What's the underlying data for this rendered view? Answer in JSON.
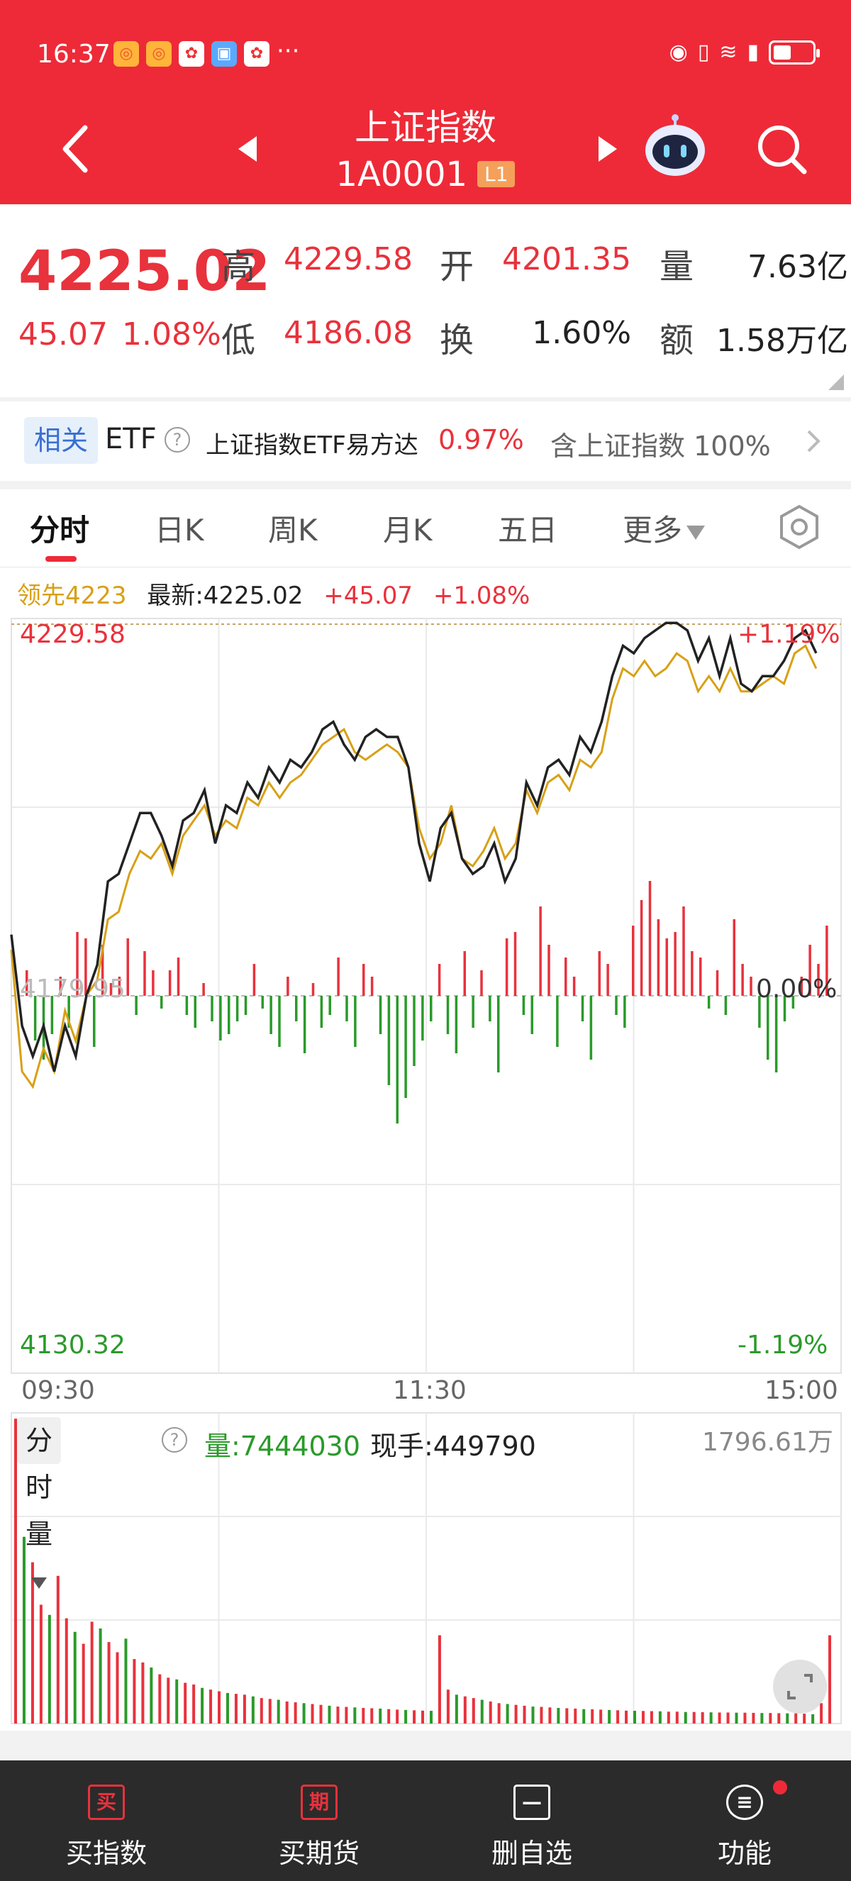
{
  "status_bar": {
    "time": "16:37",
    "more_icon": "···",
    "battery_level": 0.45
  },
  "header": {
    "title": "上证指数",
    "code": "1A0001",
    "level_badge": "L1",
    "icons": [
      "back-icon",
      "prev-arrow-icon",
      "next-arrow-icon",
      "robot-assistant-icon",
      "search-icon"
    ]
  },
  "quote": {
    "price": "4225.02",
    "change": "45.07",
    "change_pct": "1.08%",
    "high_label": "高",
    "high": "4229.58",
    "open_label": "开",
    "open": "4201.35",
    "volume_label": "量",
    "volume": "7.63亿",
    "low_label": "低",
    "low": "4186.08",
    "turnover_label": "换",
    "turnover": "1.60%",
    "amount_label": "额",
    "amount": "1.58万亿"
  },
  "etf": {
    "tag": "相关",
    "label": "ETF",
    "help": "?",
    "name": "上证指数ETF易方达",
    "pct": "0.97%",
    "holding": "含上证指数",
    "holding_pct": "100%"
  },
  "tabs": [
    {
      "label": "分时",
      "active": true
    },
    {
      "label": "日K"
    },
    {
      "label": "周K"
    },
    {
      "label": "月K"
    },
    {
      "label": "五日"
    },
    {
      "label": "更多"
    }
  ],
  "legend": {
    "leader": "领先4223",
    "latest": "最新:4225.02",
    "change": "+45.07",
    "change_pct": "+1.08%"
  },
  "volume_panel": {
    "selector": "分时量",
    "help": "?",
    "volume": "量:7444030",
    "current_hand": "现手:449790",
    "max_label": "1796.61万"
  },
  "chart_data": {
    "type": "line",
    "xlabel": "",
    "ylabel": "",
    "x_ticks": [
      "09:30",
      "11:30",
      "15:00"
    ],
    "y_max": 4229.58,
    "y_min": 4130.32,
    "prev_close_label": "4179.95",
    "y_max_pct": "+1.19%",
    "y_min_pct": "-1.19%",
    "zero_pct": "0.00%",
    "dashed_high": 4229.58,
    "series": [
      {
        "name": "最新",
        "color": "#222222",
        "values": [
          4188,
          4176,
          4172,
          4176,
          4170,
          4176,
          4172,
          4180,
          4184,
          4195,
          4196,
          4200,
          4204,
          4204,
          4201,
          4197,
          4203,
          4204,
          4207,
          4200,
          4205,
          4204,
          4208,
          4206,
          4210,
          4208,
          4211,
          4210,
          4212,
          4215,
          4216,
          4213,
          4211,
          4214,
          4215,
          4214,
          4214,
          4210,
          4200,
          4195,
          4202,
          4204,
          4198,
          4196,
          4197,
          4200,
          4195,
          4198,
          4208,
          4205,
          4210,
          4211,
          4209,
          4214,
          4212,
          4216,
          4222,
          4226,
          4225,
          4227,
          4228,
          4229,
          4229,
          4228,
          4224,
          4227,
          4222,
          4227,
          4221,
          4220,
          4222,
          4222,
          4224,
          4227,
          4228,
          4225.02
        ]
      },
      {
        "name": "领先",
        "color": "#d8a015",
        "values": [
          4186,
          4170,
          4168,
          4173,
          4170,
          4178,
          4174,
          4180,
          4182,
          4190,
          4191,
          4196,
          4199,
          4198,
          4200,
          4196,
          4201,
          4203,
          4205,
          4201,
          4203,
          4202,
          4206,
          4205,
          4208,
          4206,
          4208,
          4209,
          4211,
          4213,
          4214,
          4215,
          4212,
          4211,
          4212,
          4213,
          4212,
          4210,
          4202,
          4198,
          4200,
          4205,
          4198,
          4197,
          4199,
          4202,
          4198,
          4200,
          4207,
          4204,
          4208,
          4209,
          4207,
          4211,
          4210,
          4212,
          4219,
          4223,
          4222,
          4224,
          4222,
          4223,
          4225,
          4224,
          4220,
          4222,
          4220,
          4223,
          4220,
          4220,
          4221,
          4222,
          4221,
          4225,
          4226,
          4223
        ]
      }
    ],
    "diff_bars": [
      4,
      -7,
      -10,
      -6,
      3,
      -5,
      10,
      9,
      -8,
      8,
      2,
      3,
      9,
      -3,
      7,
      4,
      -2,
      4,
      6,
      -3,
      -5,
      2,
      -4,
      -7,
      -6,
      -4,
      -3,
      5,
      -2,
      -6,
      -8,
      3,
      -4,
      -9,
      2,
      -5,
      -3,
      6,
      -4,
      -8,
      5,
      3,
      -6,
      -14,
      -20,
      -16,
      -11,
      -7,
      -4,
      5,
      -6,
      -9,
      7,
      -5,
      4,
      -4,
      -12,
      9,
      10,
      -3,
      -6,
      14,
      8,
      -8,
      6,
      3,
      -4,
      -10,
      7,
      5,
      -3,
      -5,
      11,
      15,
      18,
      12,
      9,
      10,
      14,
      7,
      6,
      -2,
      4,
      -3,
      12,
      5,
      3,
      -5,
      -10,
      -12,
      -4,
      -2,
      3,
      8,
      5,
      11
    ]
  },
  "volume_chart": {
    "type": "bar",
    "max": 1796.61,
    "values": [
      1796,
      1100,
      950,
      700,
      640,
      870,
      620,
      540,
      470,
      600,
      560,
      480,
      420,
      500,
      380,
      360,
      330,
      290,
      270,
      260,
      240,
      230,
      210,
      200,
      190,
      180,
      175,
      170,
      160,
      150,
      145,
      140,
      130,
      125,
      120,
      115,
      110,
      105,
      100,
      98,
      95,
      92,
      90,
      88,
      85,
      82,
      80,
      78,
      76,
      75,
      520,
      200,
      170,
      160,
      150,
      140,
      130,
      120,
      115,
      110,
      105,
      100,
      98,
      95,
      92,
      90,
      88,
      85,
      84,
      82,
      80,
      78,
      76,
      75,
      74,
      73,
      72,
      70,
      70,
      68,
      68,
      67,
      66,
      65,
      65,
      64,
      64,
      63,
      62,
      62,
      61,
      60,
      60,
      58,
      55,
      120,
      520
    ]
  },
  "bottom_bar": [
    {
      "icon": "买",
      "label": "买指数"
    },
    {
      "icon": "期",
      "label": "买期货"
    },
    {
      "icon": "—",
      "label": "删自选"
    },
    {
      "icon": "≡",
      "label": "功能"
    }
  ],
  "colors": {
    "brand": "#ee2a38",
    "up": "#e8323c",
    "down": "#2a9a2a",
    "leader": "#d8a015"
  }
}
